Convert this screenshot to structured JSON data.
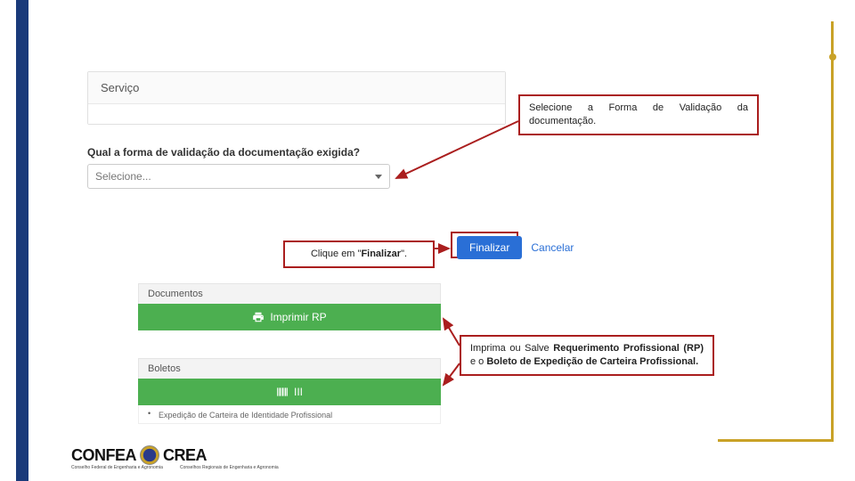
{
  "servico": {
    "header": "Serviço"
  },
  "validacao": {
    "question": "Qual a forma de validação da documentação exigida?",
    "placeholder": "Selecione..."
  },
  "callouts": {
    "c1": "Selecione a Forma de Validação da documentação.",
    "c2_pre": "Clique em \"",
    "c2_bold": "Finalizar",
    "c2_post": "\".",
    "c3_parts": {
      "t1": "Imprima ou Salve ",
      "b1": "Requerimento Profissional (RP)",
      "t2": " e o ",
      "b2": "Boleto de Expedição de Carteira Profissional.",
      "t3": ""
    }
  },
  "actions": {
    "finalizar": "Finalizar",
    "cancelar": "Cancelar"
  },
  "sections": {
    "documentos": {
      "title": "Documentos",
      "button": "Imprimir  RP"
    },
    "boletos": {
      "title": "Boletos",
      "button": "III",
      "item": "Expedição de Carteira de Identidade Profissional"
    }
  },
  "footer": {
    "confea": "CONFEA",
    "crea": "CREA",
    "sub1": "Conselho Federal de Engenharia e Agronomia",
    "sub2": "Conselhos Regionais de Engenharia e Agronomia"
  }
}
